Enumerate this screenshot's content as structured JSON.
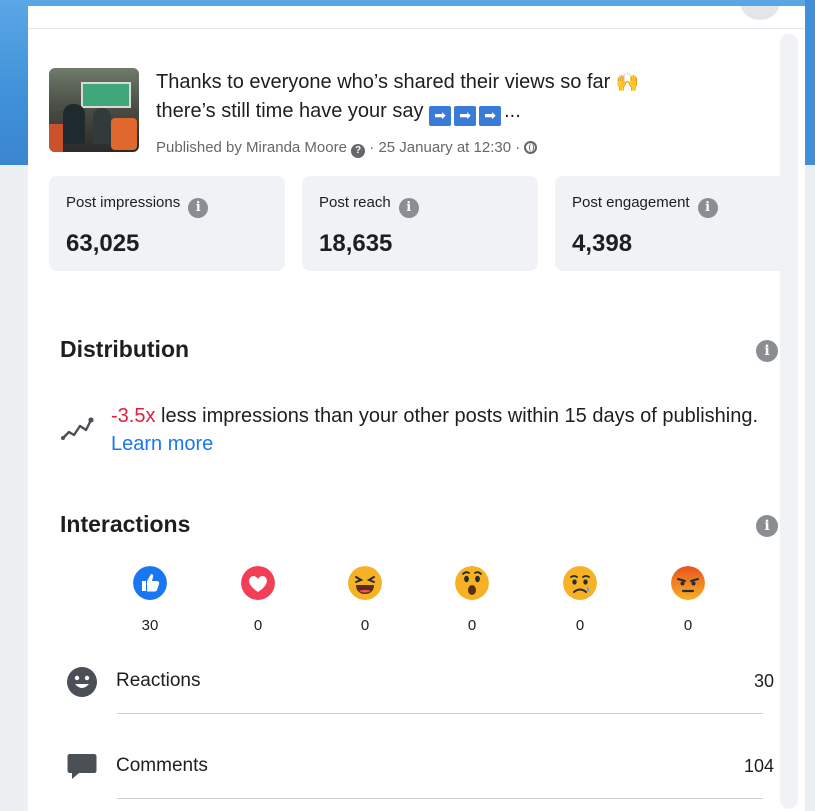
{
  "post": {
    "text_line1": "Thanks to everyone who’s shared their views so far",
    "text_line2": "there’s still time have your say",
    "ellipsis": "...",
    "arrow_glyph": "➡",
    "meta_prefix": "Published by Miranda Moore",
    "meta_suffix": "· 25 January at 12:30 ·"
  },
  "stats": [
    {
      "label": "Post impressions",
      "value": "63,025"
    },
    {
      "label": "Post reach",
      "value": "18,635"
    },
    {
      "label": "Post engagement",
      "value": "4,398"
    }
  ],
  "info_glyph": "i",
  "distribution": {
    "title": "Distribution",
    "multiplier": "-3.5x",
    "text": " less impressions than your other posts within 15 days of publishing. ",
    "link": "Learn more"
  },
  "interactions": {
    "title": "Interactions",
    "reactions": [
      {
        "icon": "like-icon",
        "count": "30"
      },
      {
        "icon": "love-icon",
        "count": "0"
      },
      {
        "icon": "haha-icon",
        "count": "0"
      },
      {
        "icon": "wow-icon",
        "count": "0"
      },
      {
        "icon": "sad-icon",
        "count": "0"
      },
      {
        "icon": "angry-icon",
        "count": "0"
      }
    ],
    "rows": [
      {
        "label": "Reactions",
        "value": "30",
        "icon": "smiley-icon"
      },
      {
        "label": "Comments",
        "value": "104",
        "icon": "comment-icon"
      }
    ]
  },
  "colors": {
    "accent": "#1877f2",
    "negative": "#e41e3f"
  }
}
